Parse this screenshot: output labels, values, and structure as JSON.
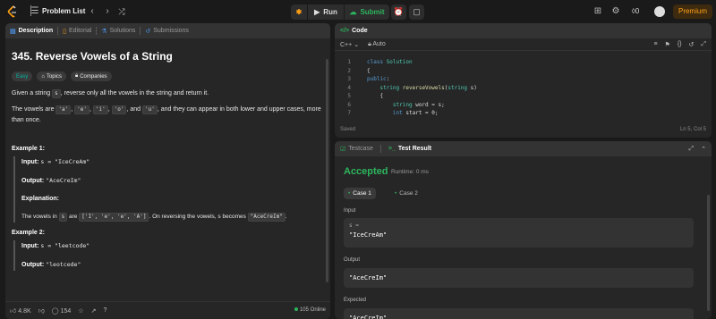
{
  "topbar": {
    "problem_list_label": "Problem List",
    "run_label": "Run",
    "submit_label": "Submit",
    "streak_count": "0",
    "premium_label": "Premium"
  },
  "left_tabs": {
    "description": "Description",
    "editorial": "Editorial",
    "solutions": "Solutions",
    "submissions": "Submissions"
  },
  "problem": {
    "title": "345. Reverse Vowels of a String",
    "difficulty": "Easy",
    "topics_label": "Topics",
    "companies_label": "Companies",
    "statement_a": "Given a string",
    "statement_code": "s",
    "statement_b": ", reverse only all the vowels in the string and return it.",
    "vowels_a": "The vowels are",
    "v1": "'a'",
    "v2": "'e'",
    "v3": "'i'",
    "v4": "'o'",
    "and": ", and",
    "v5": "'u'",
    "vowels_b": ", and they can appear in both lower and upper cases, more than once."
  },
  "examples": {
    "ex1_title": "Example 1:",
    "ex1_input_label": "Input:",
    "ex1_input": "s = \"IceCreAm\"",
    "ex1_output_label": "Output:",
    "ex1_output": "\"AceCreIm\"",
    "ex1_expl_label": "Explanation:",
    "ex1_expl_a": "The vowels in",
    "ex1_expl_s": "s",
    "ex1_expl_b": "are",
    "ex1_expl_arr": "['I', 'e', 'e', 'A']",
    "ex1_expl_c": ". On reversing the vowels, s becomes",
    "ex1_expl_res": "\"AceCreIm\"",
    "ex1_expl_d": ".",
    "ex2_title": "Example 2:",
    "ex2_input_label": "Input:",
    "ex2_input": "s = \"leetcode\"",
    "ex2_output_label": "Output:",
    "ex2_output": "\"leotcede\""
  },
  "bottombar": {
    "likes": "4.8K",
    "comments": "154",
    "online": "105 Online"
  },
  "code_panel": {
    "title": "Code",
    "language": "C++",
    "auto_label": "Auto",
    "saved": "Saved",
    "cursor": "Ln 5, Col 5",
    "lines": [
      {
        "n": "1",
        "code": "class Solution"
      },
      {
        "n": "2",
        "code": "{"
      },
      {
        "n": "3",
        "code": "public:"
      },
      {
        "n": "4",
        "code": "    string reverseVowels(string s)"
      },
      {
        "n": "5",
        "code": "    {"
      },
      {
        "n": "6",
        "code": "        string word = s;"
      },
      {
        "n": "7",
        "code": "        int start = 0;"
      }
    ]
  },
  "result_panel": {
    "testcase_tab": "Testcase",
    "result_tab": "Test Result",
    "status": "Accepted",
    "runtime": "Runtime: 0 ms",
    "case1": "Case 1",
    "case2": "Case 2",
    "input_label": "Input",
    "input_var": "s =",
    "input_value": "\"IceCreAm\"",
    "output_label": "Output",
    "output_value": "\"AceCreIm\"",
    "expected_label": "Expected",
    "expected_value": "\"AceCreIm\""
  },
  "colors": {
    "accent_orange": "#ffa116",
    "accepted_green": "#2db55d",
    "easy_teal": "#00b8a3"
  }
}
